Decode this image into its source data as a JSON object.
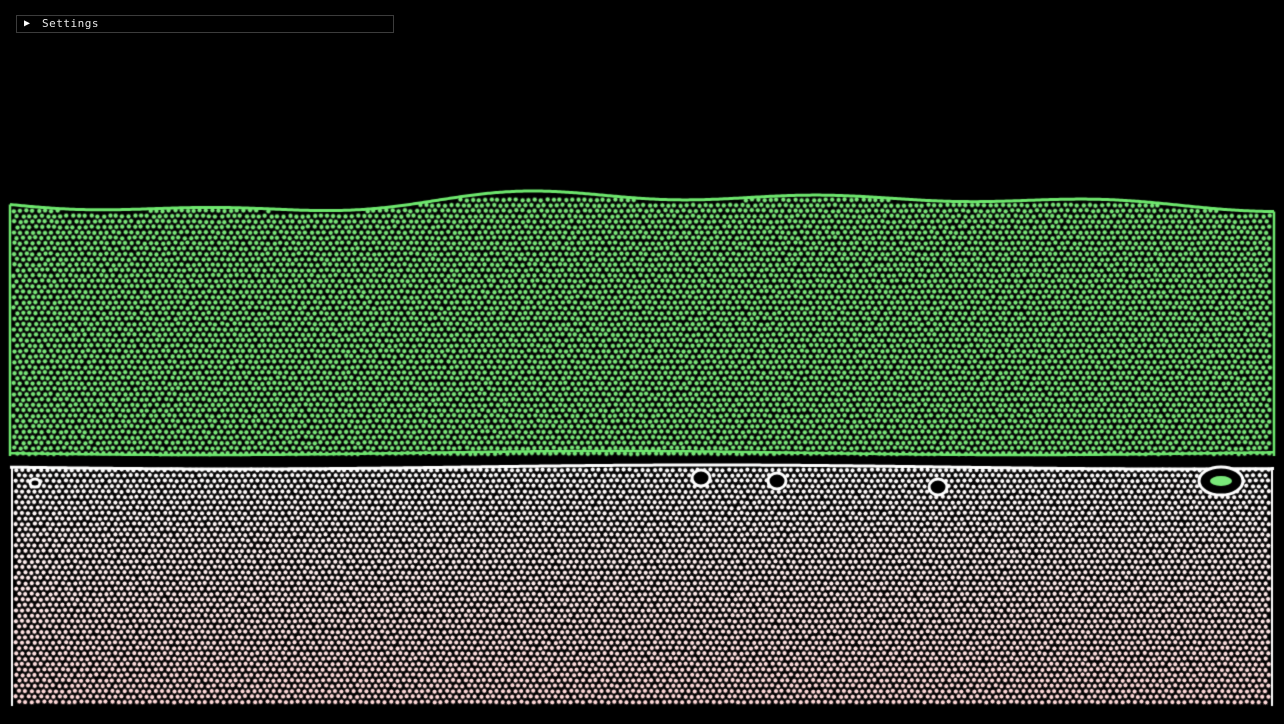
{
  "window": {
    "frame_color": "#7fa6c6"
  },
  "settings_panel": {
    "label": "Settings",
    "collapsed": true,
    "arrow_icon": "triangle-right-icon"
  },
  "simulation": {
    "top_fluid": {
      "particle_color": "#79e879",
      "particle_outline": "#1f2f1f",
      "surface_color": "#6ee86e"
    },
    "bottom_fluid": {
      "particle_color": "#fbe6e6",
      "particle_outline": "#000000",
      "interface_color": "#ffffff"
    },
    "background_color": "#000000"
  }
}
